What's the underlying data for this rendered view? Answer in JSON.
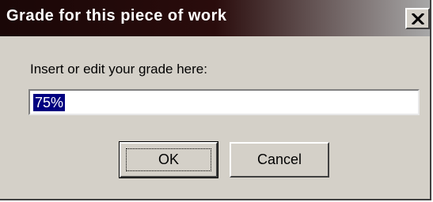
{
  "window": {
    "title": "Grade for this piece of work",
    "close_icon": "close-icon"
  },
  "form": {
    "prompt": "Insert or edit your grade here:",
    "grade_value": "75%"
  },
  "buttons": {
    "ok_label": "OK",
    "cancel_label": "Cancel"
  },
  "colors": {
    "titlebar_start": "#1a0707",
    "titlebar_end": "#a8a8a8",
    "dialog_face": "#d4d0c8",
    "selection": "#000080"
  }
}
